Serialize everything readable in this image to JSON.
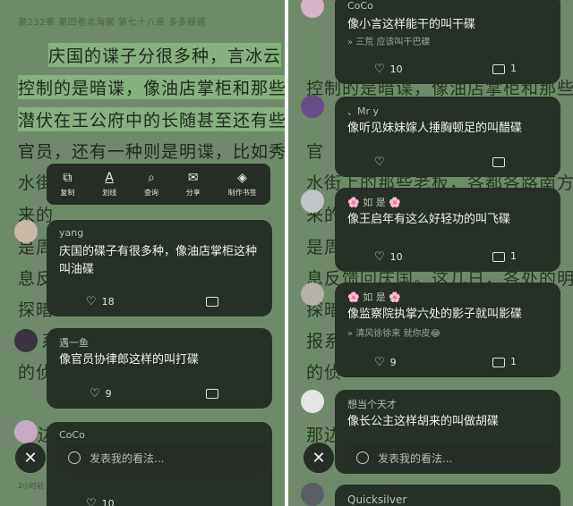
{
  "left": {
    "breadcrumb": "第232章 第四卷北海案 第七十八章 多多疑惑",
    "lines": [
      "庆国的谍子分很多种，言冰云",
      "控制的是暗谍，像油店掌柜和那些",
      "潜伏在王公府中的长随甚至还有些",
      "官员，还有一种则是明谍，比如秀",
      "水街",
      "来的",
      "是周",
      "息反",
      "探暗",
      "系",
      "的侦",
      "边"
    ],
    "toolbar": [
      {
        "icon": "copy-icon",
        "glyph": "⧉",
        "label": "复制"
      },
      {
        "icon": "underline-icon",
        "glyph": "A",
        "label": "划线"
      },
      {
        "icon": "search-icon",
        "glyph": "⌕",
        "label": "查询"
      },
      {
        "icon": "share-icon",
        "glyph": "✉",
        "label": "分享"
      },
      {
        "icon": "card-icon",
        "glyph": "◈",
        "label": "制作书签"
      }
    ],
    "comments": [
      {
        "user": "yang",
        "text": "庆国的碟子有很多种，像油店掌柜这种叫油碟",
        "likes": "18"
      },
      {
        "user": "遇一鱼",
        "text": "像官员协律郎这样的叫打碟",
        "likes": "9"
      },
      {
        "user": "CoCo",
        "text": "",
        "likes": "10"
      }
    ],
    "input_placeholder": "发表我的看法...",
    "time_note": "2小时前"
  },
  "right": {
    "lines": [
      "控制的是暗谍，像油店掌柜和那些",
      "官",
      "水街上的那些老板，各都各路南方",
      "来的",
      "是周",
      "息反馈回庆国。这几日，各处的明",
      "探暗",
      "报系",
      "的侦",
      "那边"
    ],
    "comments": [
      {
        "user": "CoCo",
        "text": "像小言这样能干的叫干碟",
        "reply": "» 三荒 应该叫干巴碟",
        "likes": "10",
        "replies": "1"
      },
      {
        "user": "、Mr y",
        "text": "像听见妹妹嫁人捶胸顿足的叫醋碟",
        "reply": "",
        "likes": "",
        "replies": ""
      },
      {
        "user": "🌸 如 是 🌸",
        "text": "像王启年有这么好轻功的叫飞碟",
        "reply": "",
        "likes": "10",
        "replies": "1"
      },
      {
        "user": "🌸 如 是 🌸",
        "text": "像监察院执掌六处的影子就叫影碟",
        "reply": "» 清风徐徐来 就你皮😂",
        "likes": "9",
        "replies": "1"
      },
      {
        "user": "想当个天才",
        "text": "像长公主这样胡来的叫做胡碟",
        "reply": "",
        "likes": "",
        "replies": ""
      },
      {
        "user": "Quicksilver",
        "text": "",
        "reply": "",
        "likes": "",
        "replies": ""
      }
    ],
    "input_placeholder": "发表我的看法..."
  },
  "close_glyph": "✕"
}
